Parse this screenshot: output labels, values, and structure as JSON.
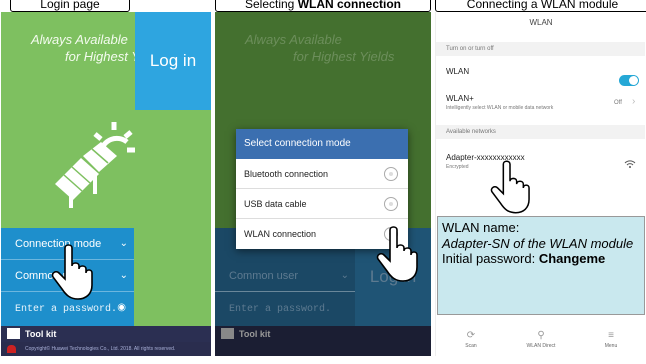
{
  "captions": {
    "login": "Login page",
    "selecting_pre": "Selecting ",
    "selecting_bold": "WLAN connection",
    "connecting": "Connecting a WLAN module"
  },
  "login_page": {
    "slogan_line1": "Always Available",
    "slogan_line2": "for Highest Yields",
    "connection_mode": "Connection mode",
    "user_type": "Common user",
    "password_placeholder": "Enter a password.",
    "login_button": "Log in",
    "toolkit": "Tool kit",
    "copyright": "Copyright© Huawei Technologies Co., Ltd. 2018. All rights reserved."
  },
  "dialog": {
    "title": "Select connection mode",
    "options": [
      "Bluetooth connection",
      "USB data cable",
      "WLAN connection"
    ]
  },
  "wlan_settings": {
    "title": "WLAN",
    "section_toggle": "Turn on or turn off",
    "wlan_label": "WLAN",
    "wlan_plus_label": "WLAN+",
    "wlan_plus_desc": "Intelligently select WLAN or mobile data network",
    "wlan_plus_state": "Off",
    "section_networks": "Available networks",
    "network_name": "Adapter-xxxxxxxxxxxx",
    "network_status": "Encrypted",
    "nav": [
      "Scan",
      "WLAN Direct",
      "Menu"
    ]
  },
  "info_box": {
    "line1": "WLAN name:",
    "line2": "Adapter-SN of the WLAN module",
    "line3_pre": "Initial password: ",
    "line3_bold": "Changeme"
  },
  "colors": {
    "green_bg": "#7ec060",
    "blue_panel": "#1e8fcc",
    "toggle_on": "#25a8d6",
    "dialog_title": "#3b6fb0",
    "info_box": "#c9e8ee"
  }
}
